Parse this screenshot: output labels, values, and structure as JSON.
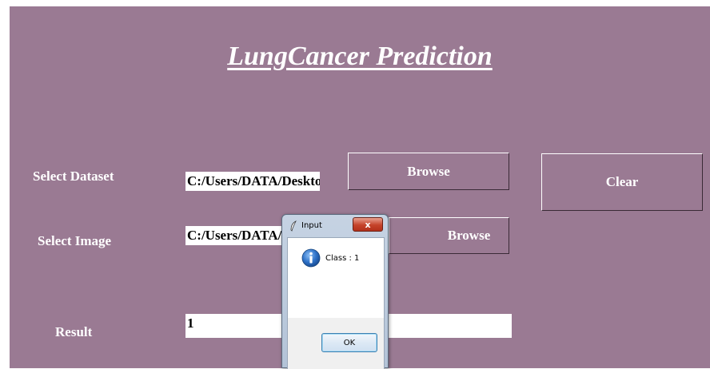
{
  "app": {
    "title": "LungCancer Prediction"
  },
  "form": {
    "dataset_label": "Select Dataset",
    "dataset_path": "C:/Users/DATA/Deskto",
    "image_label": "Select Image",
    "image_path": "C:/Users/DATA/",
    "result_label": "Result",
    "result_value": "1",
    "browse_label": "Browse",
    "clear_label": "Clear"
  },
  "dialog": {
    "title": "Input",
    "close_label": "x",
    "message": "Class : 1",
    "ok_label": "OK",
    "icon": "info-icon"
  },
  "colors": {
    "background": "#9a7a93",
    "text": "#ffffff"
  }
}
